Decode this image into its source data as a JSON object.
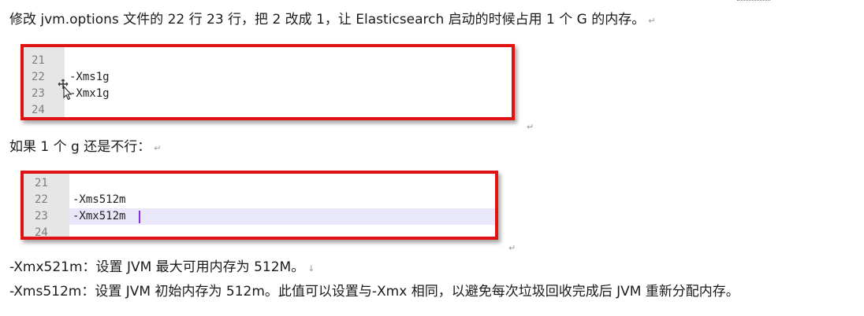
{
  "paragraphs": {
    "p1": "修改 jvm.options 文件的 22 行 23 行，把 2 改成 1，让 Elasticsearch 启动的时候占用 1 个 G 的内存。",
    "p2": "如果 1 个 g 还是不行：",
    "p3": "-Xmx521m：设置 JVM 最大可用内存为 512M。",
    "p4": "-Xms512m：设置 JVM 初始内存为 512m。此值可以设置与-Xmx 相同，以避免每次垃圾回收完成后 JVM 重新分配内存。",
    "mark": "↵",
    "mark_small": "↓"
  },
  "code_block_1": {
    "lines": [
      {
        "num": "21",
        "text": ""
      },
      {
        "num": "22",
        "text": "-Xms1g"
      },
      {
        "num": "23",
        "text": "-Xmx1g"
      },
      {
        "num": "24",
        "text": ""
      }
    ]
  },
  "code_block_2": {
    "lines": [
      {
        "num": "21",
        "text": ""
      },
      {
        "num": "22",
        "text": "-Xms512m"
      },
      {
        "num": "23",
        "text": "-Xmx512m"
      },
      {
        "num": "24",
        "text": ""
      }
    ]
  },
  "colors": {
    "box_border": "#e01212",
    "gutter": "#e6e6e6",
    "highlight": "#e8e8fa",
    "caret": "#8a2be2"
  },
  "icons": {
    "cursor": "move-cursor-icon"
  }
}
